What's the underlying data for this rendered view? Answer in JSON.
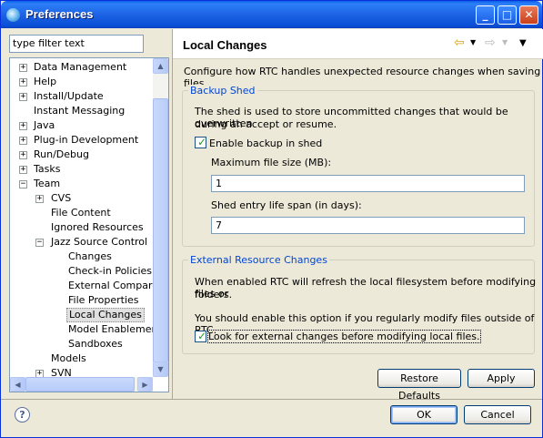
{
  "window": {
    "title": "Preferences",
    "minimize": "_",
    "maximize": "□",
    "close": "✕"
  },
  "filter": {
    "value": "type filter text"
  },
  "tree": [
    {
      "label": "Data Management",
      "level": 0,
      "toggle": "+"
    },
    {
      "label": "Help",
      "level": 0,
      "toggle": "+"
    },
    {
      "label": "Install/Update",
      "level": 0,
      "toggle": "+"
    },
    {
      "label": "Instant Messaging",
      "level": 0,
      "toggle": ""
    },
    {
      "label": "Java",
      "level": 0,
      "toggle": "+"
    },
    {
      "label": "Plug-in Development",
      "level": 0,
      "toggle": "+"
    },
    {
      "label": "Run/Debug",
      "level": 0,
      "toggle": "+"
    },
    {
      "label": "Tasks",
      "level": 0,
      "toggle": "+"
    },
    {
      "label": "Team",
      "level": 0,
      "toggle": "−"
    },
    {
      "label": "CVS",
      "level": 1,
      "toggle": "+"
    },
    {
      "label": "File Content",
      "level": 1,
      "toggle": ""
    },
    {
      "label": "Ignored Resources",
      "level": 1,
      "toggle": ""
    },
    {
      "label": "Jazz Source Control",
      "level": 1,
      "toggle": "−"
    },
    {
      "label": "Changes",
      "level": 2,
      "toggle": ""
    },
    {
      "label": "Check-in Policies",
      "level": 2,
      "toggle": ""
    },
    {
      "label": "External Compare T",
      "level": 2,
      "toggle": ""
    },
    {
      "label": "File Properties",
      "level": 2,
      "toggle": ""
    },
    {
      "label": "Local Changes",
      "level": 2,
      "toggle": "",
      "selected": true
    },
    {
      "label": "Model Enablement",
      "level": 2,
      "toggle": ""
    },
    {
      "label": "Sandboxes",
      "level": 2,
      "toggle": ""
    },
    {
      "label": "Models",
      "level": 1,
      "toggle": ""
    },
    {
      "label": "SVN",
      "level": 1,
      "toggle": "+"
    }
  ],
  "page": {
    "title": "Local Changes",
    "description": "Configure how RTC handles unexpected resource changes when saving files.",
    "backup": {
      "title": "Backup Shed",
      "text1": "The shed is used to store uncommitted changes that would be overwritten",
      "text2": "during an accept or resume.",
      "enable_label": "Enable backup in shed",
      "enable_checked": true,
      "max_size_label": "Maximum file size (MB):",
      "max_size_value": "1",
      "lifespan_label": "Shed entry life span (in days):",
      "lifespan_value": "7"
    },
    "external": {
      "title": "External Resource Changes",
      "text1": "When enabled RTC will refresh the local filesystem before modifying files or",
      "text2": "folders.",
      "text3": "You should enable this option if you regularly modify files outside of RTC.",
      "look_label": "Look for external changes before modifying local files.",
      "look_checked": true
    },
    "restore_defaults": "Restore Defaults",
    "apply": "Apply"
  },
  "footer": {
    "ok": "OK",
    "cancel": "Cancel",
    "help": "?"
  },
  "colors": {
    "titlebar": "#0a5fe8",
    "group_title": "#0046d5",
    "check": "#21a121"
  }
}
